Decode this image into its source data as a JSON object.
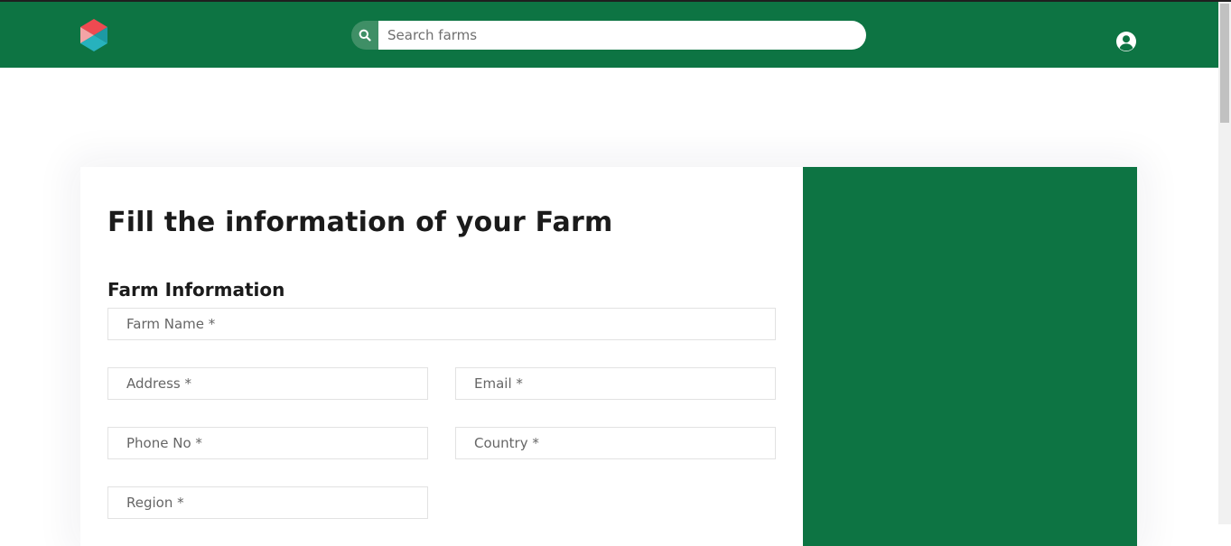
{
  "header": {
    "logo": "app-logo",
    "search": {
      "placeholder": "Search farms",
      "icon": "search-icon"
    },
    "user_icon": "user-circle-icon"
  },
  "colors": {
    "brand_green": "#0d7443",
    "search_button": "#3f8f66",
    "logo_red": "#ee4a51",
    "logo_teal": "#27b2bd"
  },
  "form": {
    "title": "Fill the information of your Farm",
    "section_title": "Farm Information",
    "fields": {
      "farm_name": "Farm Name *",
      "address": "Address *",
      "email": "Email *",
      "phone": "Phone No *",
      "country": "Country *",
      "region": "Region *"
    }
  }
}
